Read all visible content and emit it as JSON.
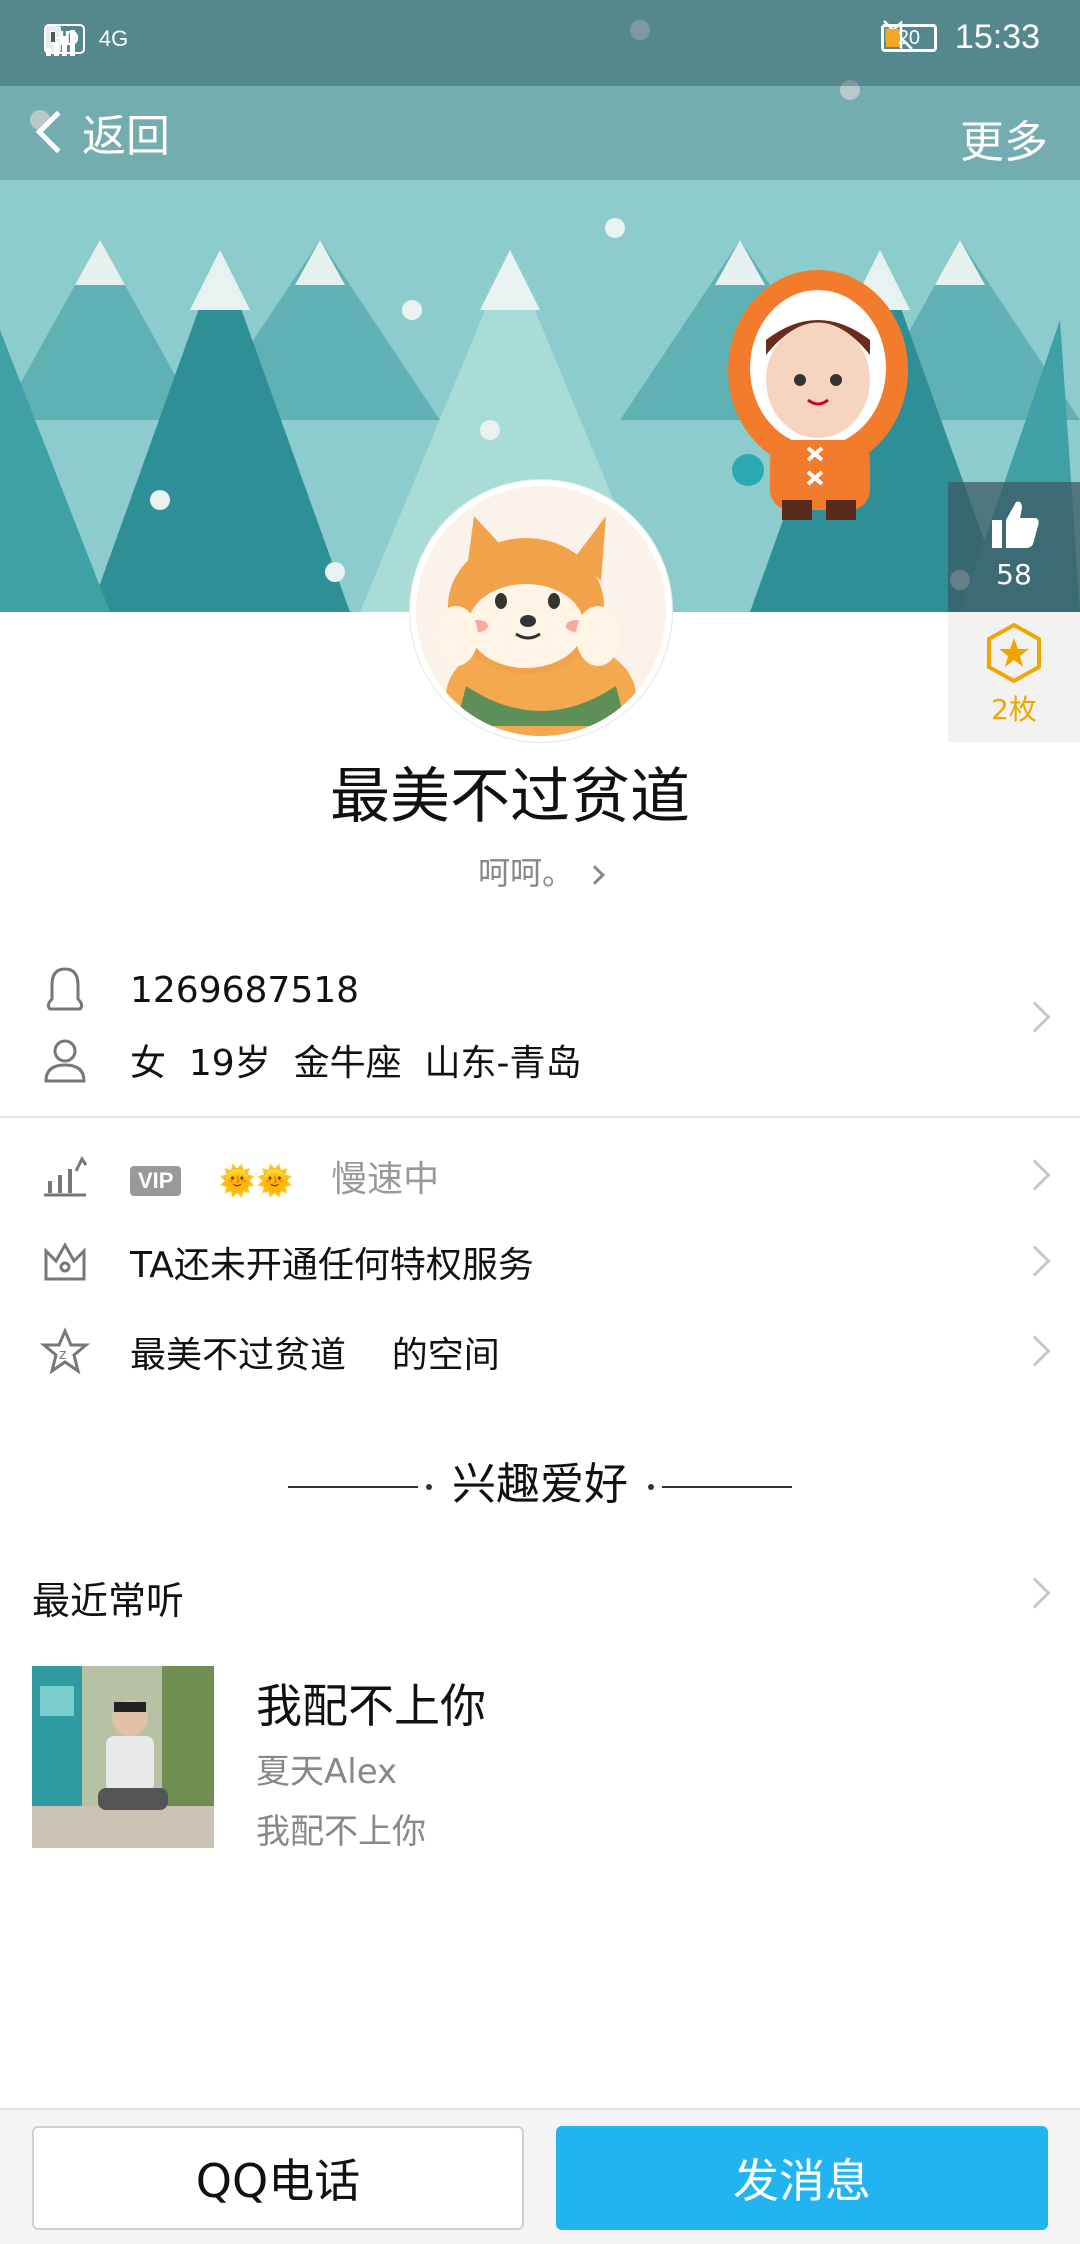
{
  "status_bar": {
    "left_indicators": [
      "HD",
      "4G"
    ],
    "battery_level": "20",
    "time": "15:33",
    "icons": [
      "hd-icon",
      "signal-icon",
      "sim-icon",
      "mute-icon",
      "battery-icon"
    ]
  },
  "nav": {
    "back_label": "返回",
    "more_label": "更多"
  },
  "side": {
    "like_count": "58",
    "badge_count": "2枚"
  },
  "profile": {
    "nickname": "最美不过贫道",
    "signature": "呵呵。",
    "qq_number": "1269687518",
    "gender": "女",
    "age": "19岁",
    "zodiac": "金牛座",
    "location": "山东-青岛"
  },
  "rows": {
    "vip_label": "VIP",
    "level_suns": "🌞🌞",
    "level_status": "慢速中",
    "privilege_text": "TA还未开通任何特权服务",
    "space_name": "最美不过贫道",
    "space_suffix": "的空间"
  },
  "interests": {
    "heading": "兴趣爱好",
    "recent_listen": "最近常听",
    "song": {
      "title": "我配不上你",
      "artist": "夏天Alex",
      "album": "我配不上你"
    }
  },
  "bottom": {
    "call_label": "QQ电话",
    "message_label": "发消息"
  },
  "colors": {
    "banner_bg": "#8ccccd",
    "accent_blue": "#22b4f0",
    "badge_gold": "#f0a500"
  }
}
